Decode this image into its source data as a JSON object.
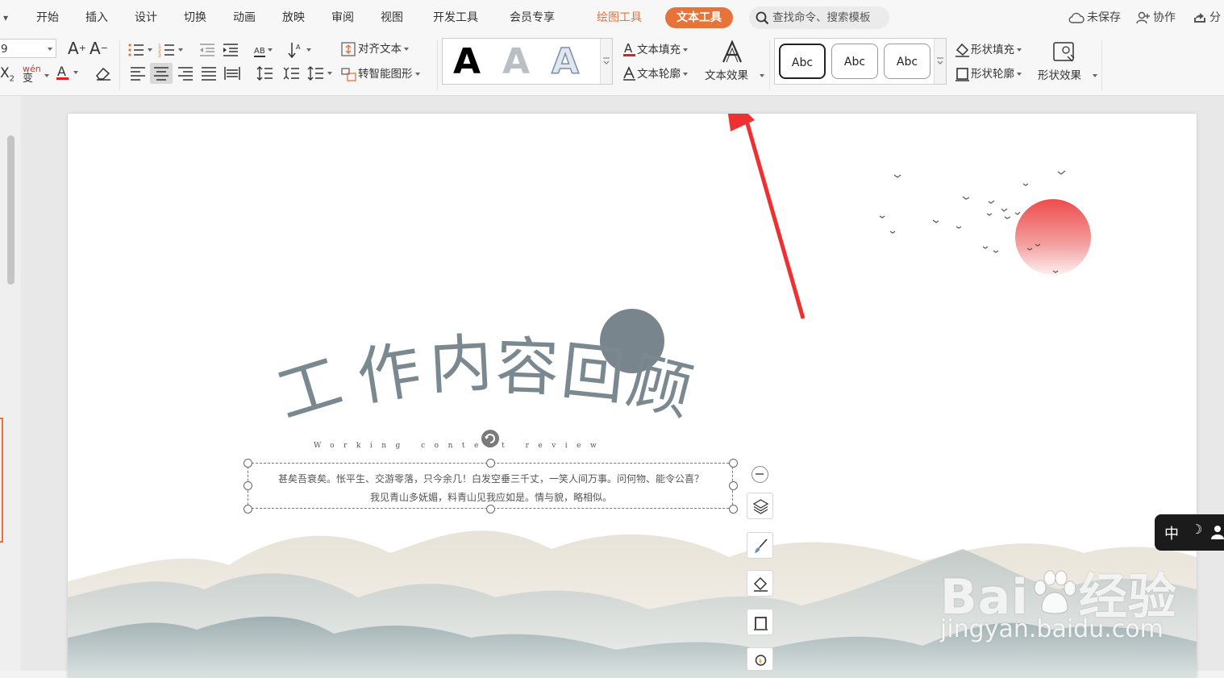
{
  "tabs": {
    "menu_caret": "▾",
    "items": [
      "开始",
      "插入",
      "设计",
      "切换",
      "动画",
      "放映",
      "审阅",
      "视图",
      "开发工具",
      "会员专享"
    ],
    "drawing_tools": "绘图工具",
    "text_tools": "文本工具",
    "search_placeholder": "查找命令、搜索模板",
    "unsaved": "未保存",
    "collaborate": "协作",
    "share": "分"
  },
  "ribbon": {
    "font_size": "9",
    "align_text": "对齐文本",
    "smart_shape": "转智能图形",
    "text_fill": "文本填充",
    "text_outline": "文本轮廓",
    "text_effect": "文本效果",
    "shape_fill": "形状填充",
    "shape_outline": "形状轮廓",
    "shape_effect": "形状效果",
    "style_letters": [
      "A",
      "A",
      "A"
    ],
    "shape_styles": [
      "Abc",
      "Abc",
      "Abc"
    ],
    "wen_label": "wén",
    "wen_char": "变",
    "ab_label": "AB",
    "x2_label": "X",
    "x2_sub": "2",
    "grow_font": "A",
    "shrink_font": "A"
  },
  "slide": {
    "title": "工作内容回顾",
    "subtitle": "Working content review",
    "body_line1": "甚矣吾衰矣。怅平生、交游零落，只今余几！白发空垂三千丈，一笑人间万事。问何物、能令公喜？",
    "body_line2": "我见青山多妩媚，料青山见我应如是。情与貌，略相似。"
  },
  "ime": {
    "mode": "中",
    "moon": "☽"
  },
  "watermark": {
    "brand": "Bai",
    "brand_cn": "经验",
    "url": "jingyan.baidu.com"
  },
  "colors": {
    "accent": "#e8733a",
    "title_gray": "#7a8890",
    "arrow_red": "#f03030",
    "sun_red": "#ee5555"
  }
}
